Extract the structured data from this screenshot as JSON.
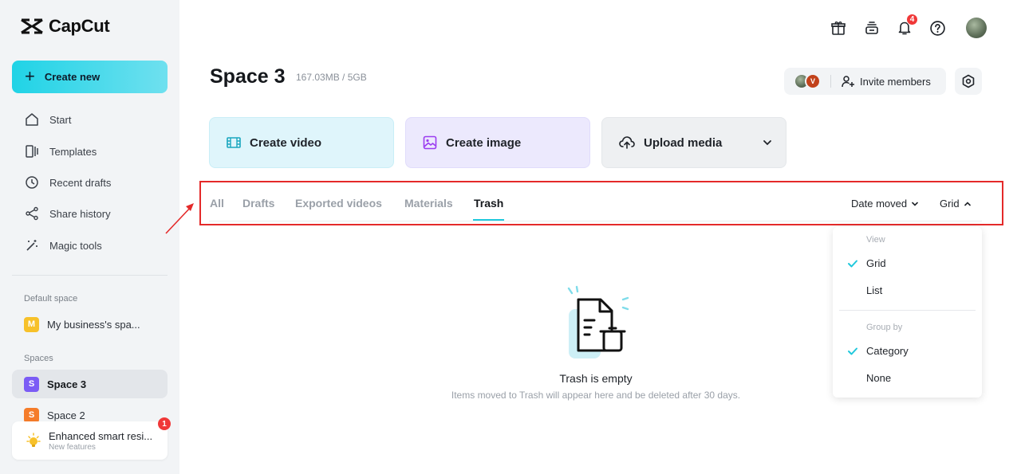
{
  "app": {
    "name": "CapCut"
  },
  "sidebar": {
    "create_new": "Create new",
    "nav": [
      {
        "label": "Start",
        "icon": "home-icon"
      },
      {
        "label": "Templates",
        "icon": "templates-icon"
      },
      {
        "label": "Recent drafts",
        "icon": "clock-icon"
      },
      {
        "label": "Share history",
        "icon": "share-icon"
      },
      {
        "label": "Magic tools",
        "icon": "magic-wand-icon"
      }
    ],
    "default_space_label": "Default space",
    "default_space": {
      "badge": "M",
      "name": "My business's spa...",
      "color": "#f7c12a"
    },
    "spaces_label": "Spaces",
    "spaces": [
      {
        "badge": "S",
        "name": "Space 3",
        "color": "#7b5cf5",
        "active": true
      },
      {
        "badge": "S",
        "name": "Space 2",
        "color": "#f57c2a",
        "active": false
      }
    ],
    "notice": {
      "title": "Enhanced smart resi...",
      "subtitle": "New features",
      "badge": "1"
    }
  },
  "header": {
    "notification_count": "4"
  },
  "space": {
    "title": "Space 3",
    "storage": "167.03MB / 5GB",
    "member_initial": "V",
    "invite_label": "Invite members"
  },
  "actions": {
    "create_video": "Create video",
    "create_image": "Create image",
    "upload_media": "Upload media"
  },
  "tabs": [
    {
      "label": "All",
      "active": false
    },
    {
      "label": "Drafts",
      "active": false
    },
    {
      "label": "Exported videos",
      "active": false
    },
    {
      "label": "Materials",
      "active": false
    },
    {
      "label": "Trash",
      "active": true
    }
  ],
  "sort": {
    "label": "Date moved",
    "view": "Grid"
  },
  "view_menu": {
    "view_label": "View",
    "view_options": [
      {
        "label": "Grid",
        "checked": true
      },
      {
        "label": "List",
        "checked": false
      }
    ],
    "group_label": "Group by",
    "group_options": [
      {
        "label": "Category",
        "checked": true
      },
      {
        "label": "None",
        "checked": false
      }
    ]
  },
  "empty_state": {
    "title": "Trash is empty",
    "description": "Items moved to Trash will appear here and be deleted after 30 days."
  },
  "colors": {
    "accent": "#20c8dc",
    "highlight": "#e42a2a",
    "badge": "#f03838"
  }
}
